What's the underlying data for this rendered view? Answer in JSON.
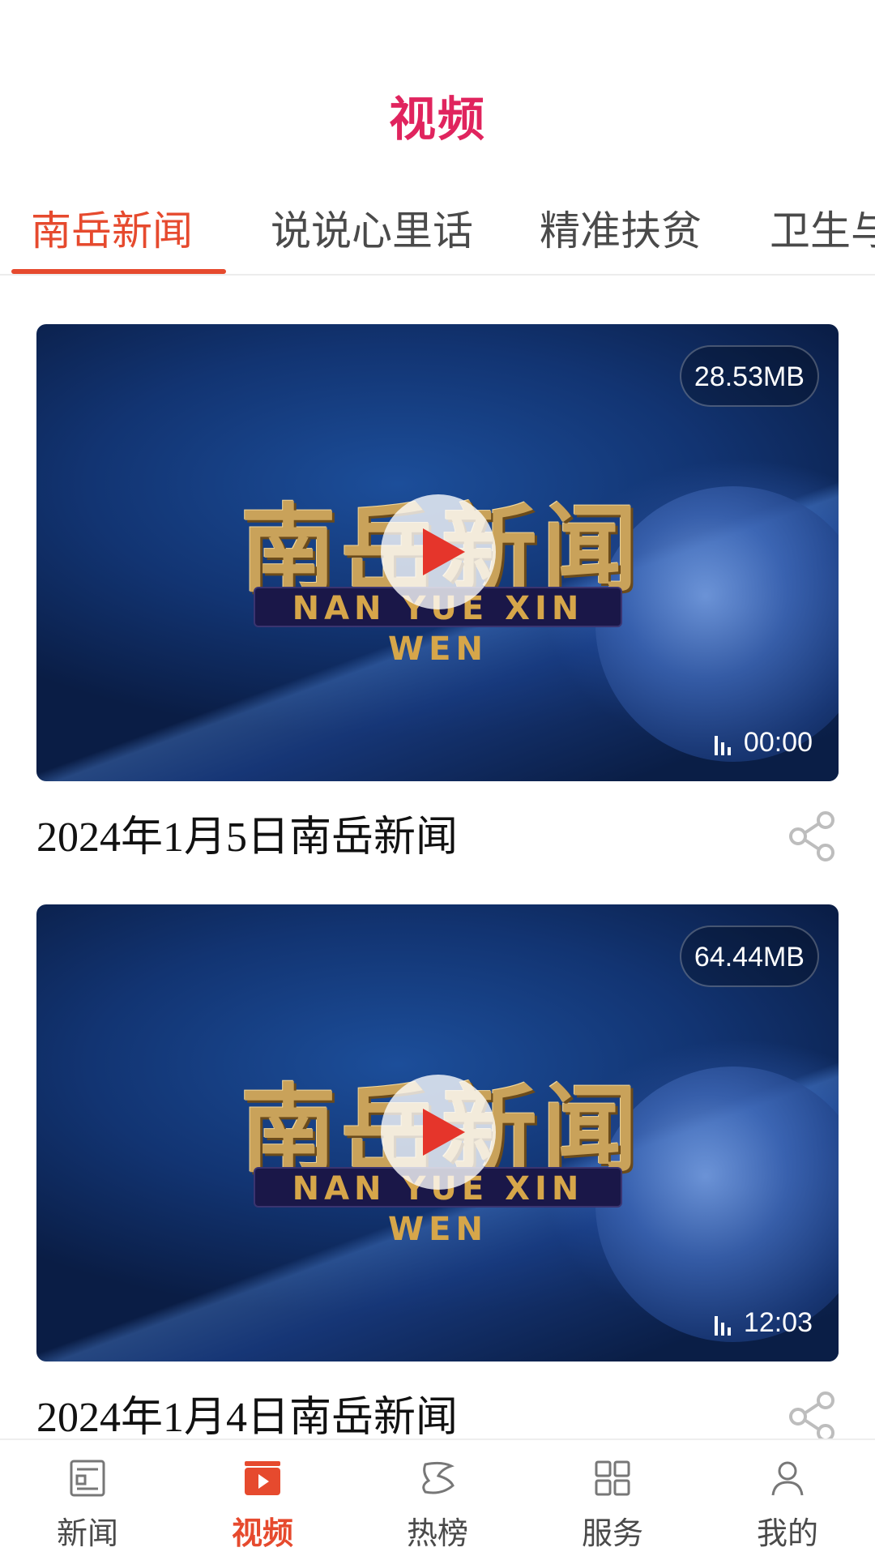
{
  "header": {
    "title": "视频"
  },
  "tabs": [
    {
      "label": "南岳新闻",
      "active": true
    },
    {
      "label": "说说心里话",
      "active": false
    },
    {
      "label": "精准扶贫",
      "active": false
    },
    {
      "label": "卫生与"
    }
  ],
  "videos": [
    {
      "logo_cn": "南岳新闻",
      "logo_en": "NAN YUE XIN WEN",
      "size": "28.53MB",
      "duration": "00:00",
      "title": "2024年1月5日南岳新闻"
    },
    {
      "logo_cn": "南岳新闻",
      "logo_en": "NAN YUE XIN WEN",
      "size": "64.44MB",
      "duration": "12:03",
      "title": "2024年1月4日南岳新闻"
    }
  ],
  "bottom_nav": [
    {
      "label": "新闻",
      "icon": "news-icon",
      "active": false
    },
    {
      "label": "视频",
      "icon": "video-icon",
      "active": true
    },
    {
      "label": "热榜",
      "icon": "hot-list-icon",
      "active": false
    },
    {
      "label": "服务",
      "icon": "grid-icon",
      "active": false
    },
    {
      "label": "我的",
      "icon": "user-icon",
      "active": false
    }
  ],
  "colors": {
    "brand_pink": "#e0245e",
    "accent_red": "#e64a2e",
    "text_dark": "#111111",
    "text_gray": "#4a4a4a"
  }
}
